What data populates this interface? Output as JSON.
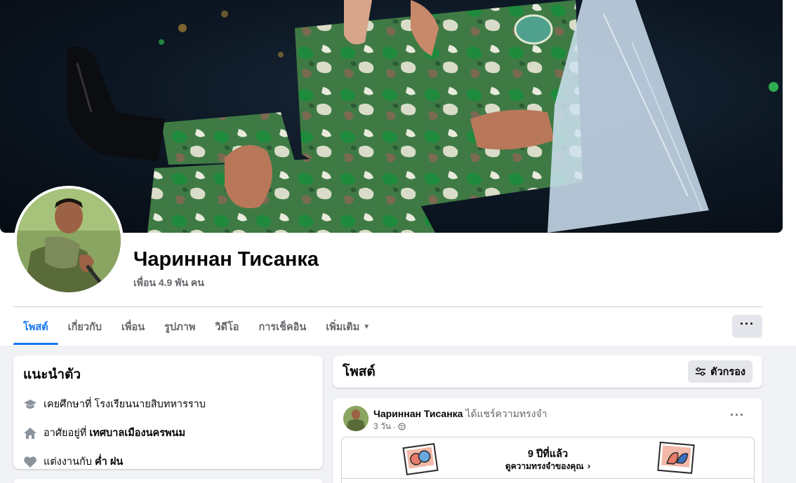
{
  "profile": {
    "name": "Чариннан Тисанка",
    "friends": "เพื่อน 4.9 พัน คน"
  },
  "tabs": [
    {
      "label": "โพสต์",
      "active": true
    },
    {
      "label": "เกี่ยวกับ",
      "active": false
    },
    {
      "label": "เพื่อน",
      "active": false
    },
    {
      "label": "รูปภาพ",
      "active": false
    },
    {
      "label": "วิดีโอ",
      "active": false
    },
    {
      "label": "การเช็คอิน",
      "active": false
    },
    {
      "label": "เพิ่มเติม",
      "active": false,
      "dropdown": true
    }
  ],
  "more_button": "···",
  "intro": {
    "title": "แนะนำตัว",
    "items": [
      {
        "icon": "graduation-cap-icon",
        "prefix": "เคยศึกษาที่",
        "value": "โรงเรียนนายสิบทหารราบ",
        "bold": false
      },
      {
        "icon": "home-icon",
        "prefix": "อาศัยอยู่ที่",
        "value": "เทศบาลเมืองนครพนม",
        "bold": true
      },
      {
        "icon": "heart-icon",
        "prefix": "แต่งงานกับ",
        "value": "ค่ำ ฝน",
        "bold": true
      }
    ]
  },
  "posts": {
    "title": "โพสต์",
    "filter_label": "ตัวกรอง"
  },
  "post": {
    "author": "Чариннан Тисанка",
    "action": "ได้แชร์ความทรงจำ",
    "time": "3 วัน",
    "menu": "···",
    "memory": {
      "years": "9 ปีที่แล้ว",
      "link": "ดูความทรงจำของคุณ"
    }
  },
  "colors": {
    "accent": "#1877f2",
    "muted_text": "#65676b",
    "background": "#f0f2f5"
  }
}
